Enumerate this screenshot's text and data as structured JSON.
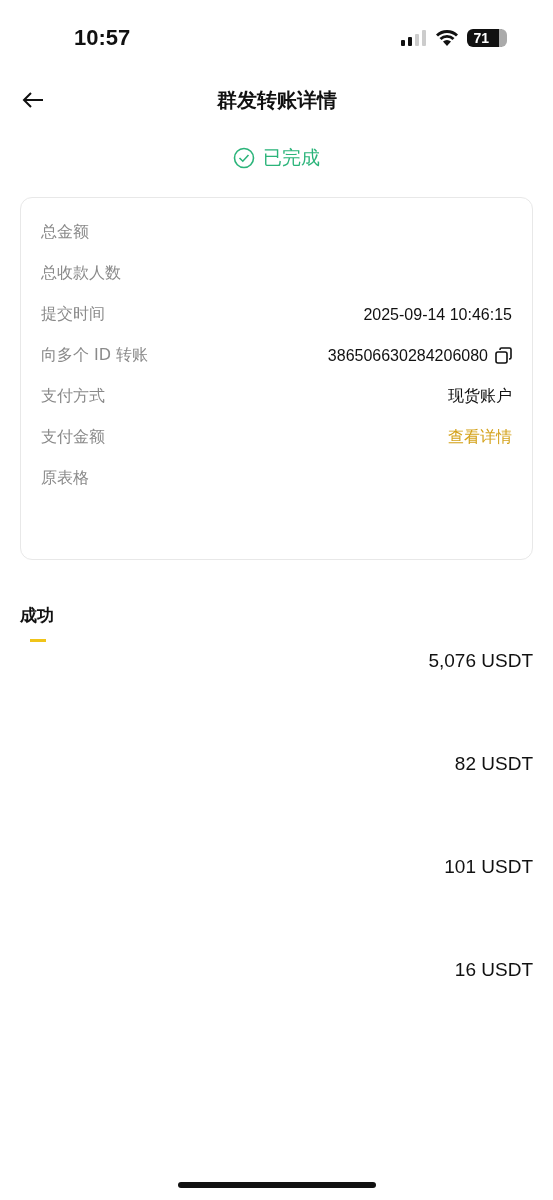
{
  "status_bar": {
    "time": "10:57",
    "battery": "71"
  },
  "header": {
    "title": "群发转账详情"
  },
  "status": {
    "label": "已完成"
  },
  "details": [
    {
      "label": "总金额",
      "kind": "hidden"
    },
    {
      "label": "总收款人数",
      "kind": "hidden"
    },
    {
      "label": "提交时间",
      "kind": "text",
      "value": "2025-09-14 10:46:15"
    },
    {
      "label": "向多个 ID 转账",
      "kind": "copy",
      "value": "386506630284206080"
    },
    {
      "label": "支付方式",
      "kind": "text",
      "value": "现货账户"
    },
    {
      "label": "支付金额",
      "kind": "link",
      "value": "查看详情"
    },
    {
      "label": "原表格",
      "kind": "hidden"
    }
  ],
  "tabs": [
    {
      "label": "成功",
      "selected": true
    }
  ],
  "recipients": [
    {
      "amount": "5,076 USDT"
    },
    {
      "amount": "82 USDT"
    },
    {
      "amount": "101 USDT"
    },
    {
      "amount": "16 USDT"
    }
  ]
}
